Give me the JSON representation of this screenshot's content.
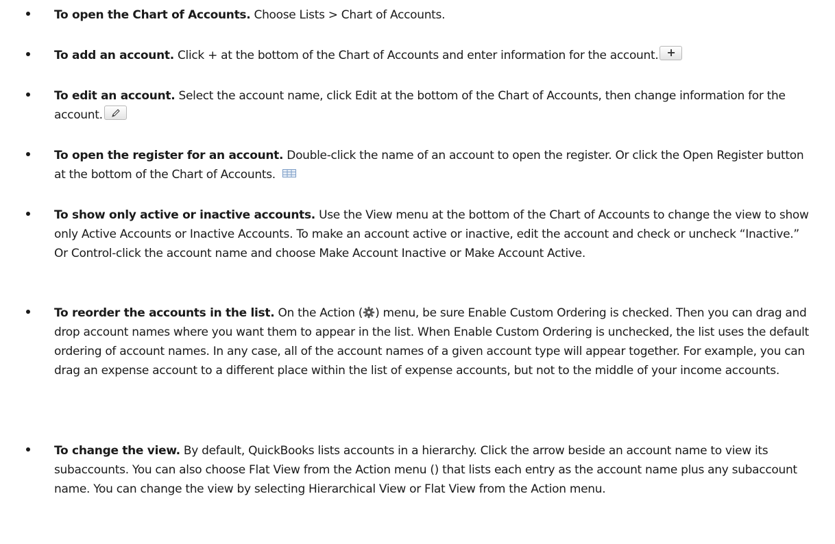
{
  "items": [
    {
      "lead": "To open the Chart of Accounts.",
      "text": " Choose Lists > Chart of Accounts."
    },
    {
      "lead": "To add an account.",
      "text": " Click + at the bottom of the Chart of Accounts and enter information for the account.",
      "icon": "plus-button-icon",
      "icon_glyph": "+"
    },
    {
      "lead": "To edit an account.",
      "text": " Select the account name, click Edit at the bottom of the Chart of Accounts, then change information for the account.",
      "icon": "pencil-icon"
    },
    {
      "lead": "To open the register for an account.",
      "text": " Double-click the name of an account to open the register. Or click the Open Register button at the bottom of the Chart of Accounts.",
      "icon": "register-grid-icon"
    },
    {
      "lead": "To show only active or inactive accounts.",
      "text": " Use the View menu at the bottom of the Chart of Accounts to change the view to show only Active Accounts or Inactive Accounts. To make an account active or inactive, edit the account and check or uncheck “Inactive.” Or Control-click the account name and choose Make Account Inactive or Make Account Active."
    },
    {
      "lead": "To reorder the accounts in the list.",
      "text_before_icon": " On the Action (",
      "icon": "gear-icon",
      "text_after_icon": ") menu, be sure Enable Custom Ordering is checked. Then you can drag and drop account names where you want them to appear in the list. When Enable Custom Ordering is unchecked, the list uses the default ordering of account names. In any case, all of the account names of a given account type will appear together. For example, you can drag an expense account to a different place within the list of expense accounts, but not to the middle of your income accounts."
    },
    {
      "lead": "To change the view.",
      "text": " By default, QuickBooks lists accounts in a hierarchy. Click the arrow beside an account name to view its subaccounts. You can also choose Flat View from the Action menu () that lists each entry as the account name plus any subaccount name. You can change the view by selecting Hierarchical View or Flat View from the Action menu."
    }
  ]
}
